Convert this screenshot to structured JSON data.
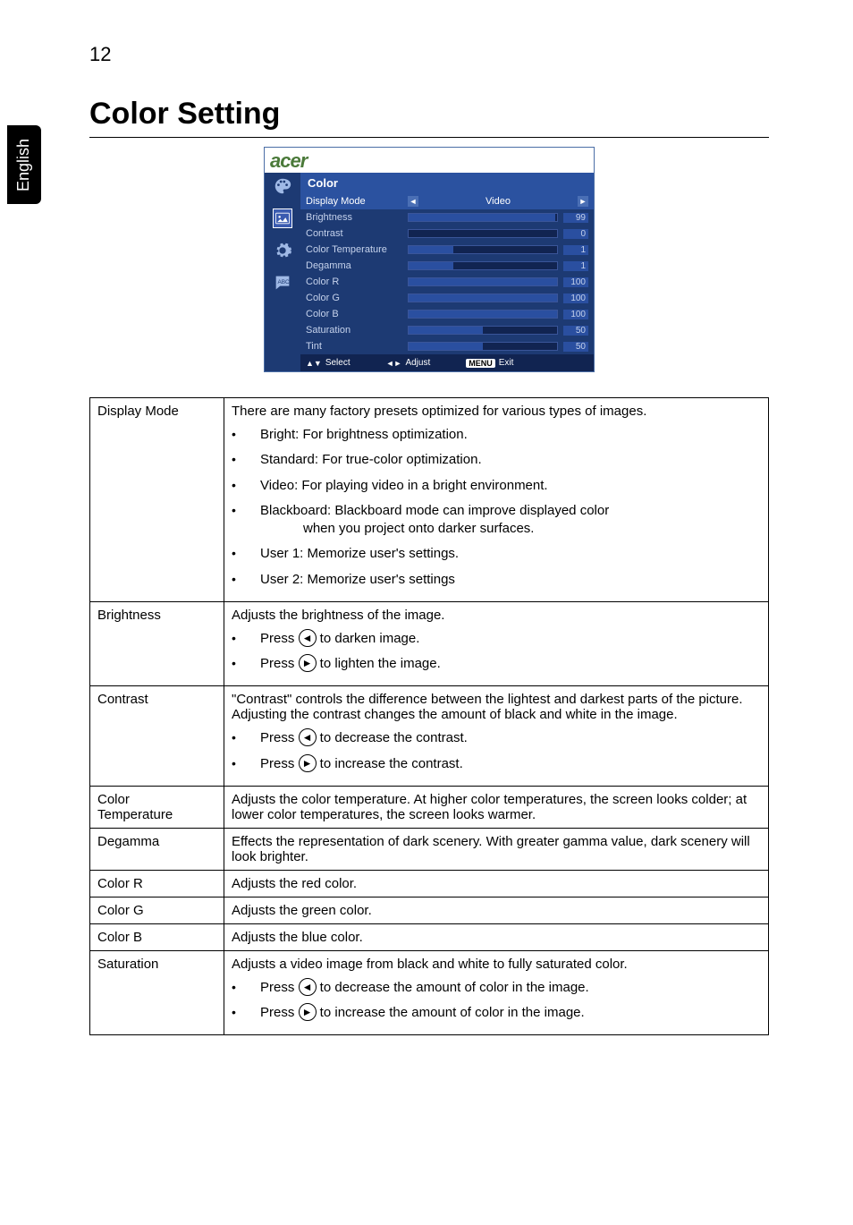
{
  "page": {
    "number": "12",
    "language_tab": "English",
    "title": "Color Setting"
  },
  "osd": {
    "logo": "acer",
    "panel_title": "Color",
    "items": [
      {
        "label": "Display Mode",
        "mode": "Video"
      },
      {
        "label": "Brightness",
        "value": "99",
        "fill": 99
      },
      {
        "label": "Contrast",
        "value": "0",
        "fill": 0
      },
      {
        "label": "Color Temperature",
        "value": "1",
        "fill": 30
      },
      {
        "label": "Degamma",
        "value": "1",
        "fill": 30
      },
      {
        "label": "Color R",
        "value": "100",
        "fill": 100
      },
      {
        "label": "Color G",
        "value": "100",
        "fill": 100
      },
      {
        "label": "Color B",
        "value": "100",
        "fill": 100
      },
      {
        "label": "Saturation",
        "value": "50",
        "fill": 50
      },
      {
        "label": "Tint",
        "value": "50",
        "fill": 50
      }
    ],
    "footer": {
      "select": "Select",
      "adjust": "Adjust",
      "menu": "MENU",
      "exit": "Exit"
    }
  },
  "rows": {
    "display_mode": {
      "name": "Display Mode",
      "intro": "There are many factory presets optimized for various types of images.",
      "bullets": [
        "Bright: For brightness optimization.",
        "Standard: For true-color optimization.",
        "Video: For playing video in a bright environment.",
        "Blackboard: Blackboard mode can improve displayed color",
        "User 1: Memorize user's settings.",
        "User 2: Memorize user's settings"
      ],
      "blackboard_cont": "when you project onto darker surfaces."
    },
    "brightness": {
      "name": "Brightness",
      "intro": "Adjusts the brightness of the image.",
      "b1a": "Press ",
      "b1b": " to darken image.",
      "b2a": "Press ",
      "b2b": " to lighten the image."
    },
    "contrast": {
      "name": "Contrast",
      "intro": "\"Contrast\" controls the difference between the lightest and darkest parts of the picture. Adjusting the contrast changes the amount of black and white in the image.",
      "b1a": "Press ",
      "b1b": " to decrease the contrast.",
      "b2a": "Press ",
      "b2b": " to increase the contrast."
    },
    "color_temp": {
      "name1": "Color",
      "name2": "Temperature",
      "desc": "Adjusts the color temperature. At higher color temperatures, the screen looks colder; at lower color temperatures, the screen looks warmer."
    },
    "degamma": {
      "name": "Degamma",
      "desc": "Effects the representation of dark scenery. With greater gamma value, dark scenery will look brighter."
    },
    "color_r": {
      "name": "Color R",
      "desc": "Adjusts the red color."
    },
    "color_g": {
      "name": "Color G",
      "desc": "Adjusts the green color."
    },
    "color_b": {
      "name": "Color B",
      "desc": "Adjusts the blue color."
    },
    "saturation": {
      "name": "Saturation",
      "intro": "Adjusts a video image from black and white to fully saturated color.",
      "b1a": "Press ",
      "b1b": " to decrease the amount of color in the image.",
      "b2a": "Press ",
      "b2b": " to increase the amount of color in the image."
    }
  }
}
